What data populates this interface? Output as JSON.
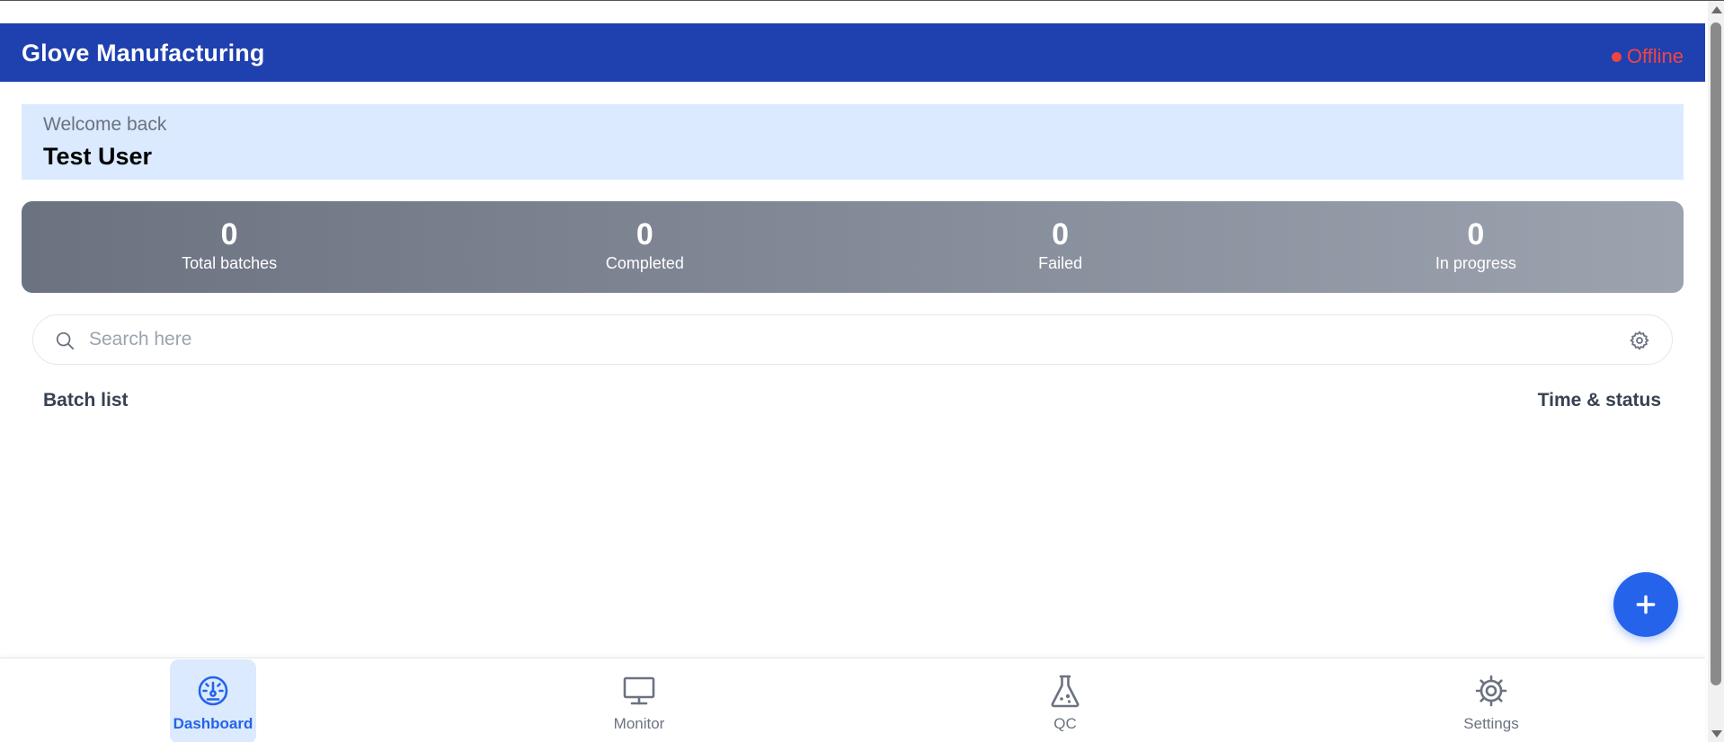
{
  "header": {
    "title": "Glove Manufacturing",
    "status": "Offline",
    "status_color": "#ef4444",
    "background": "#1f40af"
  },
  "welcome": {
    "greeting": "Welcome back",
    "user": "Test User"
  },
  "stats": [
    {
      "value": "0",
      "label": "Total batches"
    },
    {
      "value": "0",
      "label": "Completed"
    },
    {
      "value": "0",
      "label": "Failed"
    },
    {
      "value": "0",
      "label": "In progress"
    }
  ],
  "search": {
    "placeholder": "Search here"
  },
  "list": {
    "left_heading": "Batch list",
    "right_heading": "Time & status",
    "items": []
  },
  "nav": {
    "items": [
      {
        "label": "Dashboard",
        "icon": "dashboard-gauge-icon",
        "active": true
      },
      {
        "label": "Monitor",
        "icon": "monitor-icon",
        "active": false
      },
      {
        "label": "QC",
        "icon": "flask-icon",
        "active": false
      },
      {
        "label": "Settings",
        "icon": "gear-icon",
        "active": false
      }
    ]
  },
  "colors": {
    "accent": "#2563eb",
    "welcome_bg": "#dbeafe",
    "active_nav_bg": "#dbeafe"
  }
}
